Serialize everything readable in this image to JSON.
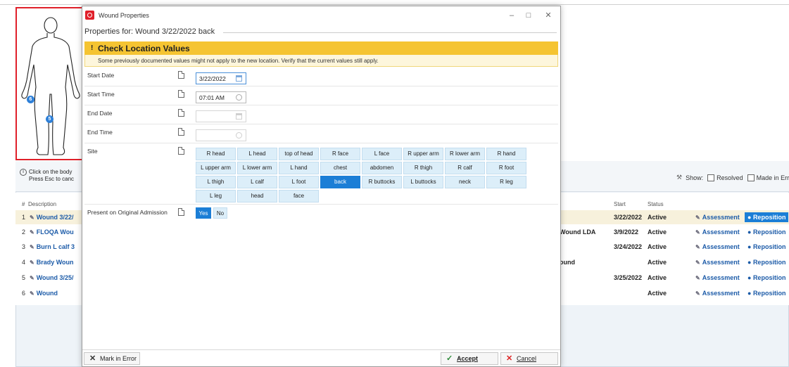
{
  "dialog": {
    "title": "Wound Properties",
    "properties_for": "Properties for: Wound 3/22/2022 back",
    "warning": {
      "title": "Check Location Values",
      "message": "Some previously documented values might not apply to the new location. Verify that the current values still apply."
    },
    "fields": {
      "start_date": {
        "label": "Start Date",
        "value": "3/22/2022"
      },
      "start_time": {
        "label": "Start Time",
        "value": "07:01 AM"
      },
      "end_date": {
        "label": "End Date",
        "value": ""
      },
      "end_time": {
        "label": "End Time",
        "value": ""
      },
      "site": {
        "label": "Site",
        "options": [
          "R head",
          "L head",
          "top of head",
          "R face",
          "L face",
          "R upper arm",
          "R lower arm",
          "R hand",
          "L upper arm",
          "L lower arm",
          "L hand",
          "chest",
          "abdomen",
          "R thigh",
          "R calf",
          "R foot",
          "L thigh",
          "L calf",
          "L foot",
          "back",
          "R buttocks",
          "L buttocks",
          "neck",
          "R leg",
          "L leg",
          "head",
          "face"
        ],
        "selected": "back"
      },
      "present_on_admission": {
        "label": "Present on Original Admission",
        "yes": "Yes",
        "no": "No",
        "selected": "Yes"
      }
    },
    "footer": {
      "mark_error": "Mark in Error",
      "accept": "Accept",
      "cancel": "Cancel"
    }
  },
  "background": {
    "hint_line1": "Click on the body",
    "hint_line2": "Press Esc to canc",
    "show_label": "Show:",
    "resolved_label": "Resolved",
    "made_in_error_label": "Made in Erro",
    "columns": {
      "num": "#",
      "description": "Description",
      "start": "Start",
      "status": "Status"
    },
    "rows": [
      {
        "num": "1",
        "desc": "Wound 3/22/",
        "mid": "",
        "start": "3/22/2022",
        "status": "Active",
        "assess": "Assessment",
        "repos": "Reposition"
      },
      {
        "num": "2",
        "desc": "FLOQA Wou",
        "mid": "Wound LDA",
        "start": "3/9/2022",
        "status": "Active",
        "assess": "Assessment",
        "repos": "Reposition"
      },
      {
        "num": "3",
        "desc": "Burn L calf 3",
        "mid": "",
        "start": "3/24/2022",
        "status": "Active",
        "assess": "Assessment",
        "repos": "Reposition"
      },
      {
        "num": "4",
        "desc": "Brady Woun",
        "mid": "ound",
        "start": "",
        "status": "Active",
        "assess": "Assessment",
        "repos": "Reposition"
      },
      {
        "num": "5",
        "desc": "Wound 3/25/",
        "mid": "",
        "start": "3/25/2022",
        "status": "Active",
        "assess": "Assessment",
        "repos": "Reposition"
      },
      {
        "num": "6",
        "desc": "Wound",
        "mid": "",
        "start": "",
        "status": "Active",
        "assess": "Assessment",
        "repos": "Reposition"
      }
    ],
    "markers": [
      "6",
      "5"
    ]
  }
}
